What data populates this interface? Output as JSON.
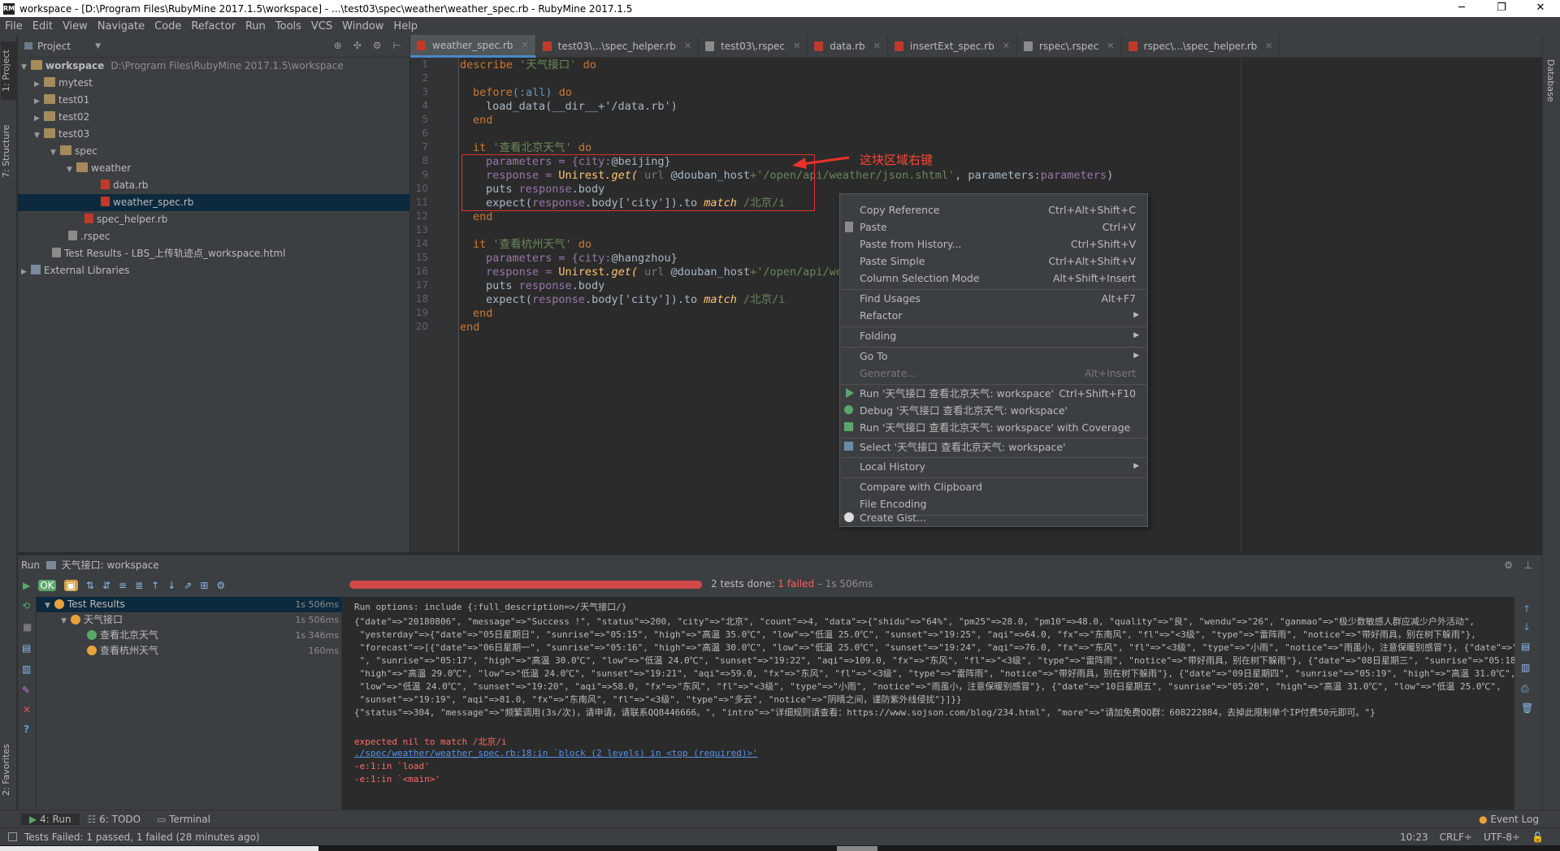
{
  "window": {
    "title": "workspace - [D:\\Program Files\\RubyMine 2017.1.5\\workspace] - ...\\test03\\spec\\weather\\weather_spec.rb - RubyMine 2017.1.5",
    "app_icon": "RM"
  },
  "menu": [
    "File",
    "Edit",
    "View",
    "Navigate",
    "Code",
    "Refactor",
    "Run",
    "Tools",
    "VCS",
    "Window",
    "Help"
  ],
  "left_strip": {
    "project": "1: Project",
    "structure": "7: Structure",
    "favorites": "2: Favorites"
  },
  "right_strip": {
    "database": "Database"
  },
  "project": {
    "header": "Project",
    "tree": [
      {
        "label": "workspace",
        "path": "D:\\Program Files\\RubyMine 2017.1.5\\workspace"
      },
      {
        "label": "mytest"
      },
      {
        "label": "test01"
      },
      {
        "label": "test02"
      },
      {
        "label": "test03"
      },
      {
        "label": "spec"
      },
      {
        "label": "weather"
      },
      {
        "label": "data.rb"
      },
      {
        "label": "weather_spec.rb"
      },
      {
        "label": "spec_helper.rb"
      },
      {
        "label": ".rspec"
      },
      {
        "label": "Test Results - LBS_上传轨迹点_workspace.html"
      },
      {
        "label": "External Libraries"
      }
    ]
  },
  "tabs": [
    "weather_spec.rb",
    "test03\\...\\spec_helper.rb",
    "test03\\.rspec",
    "data.rb",
    "insertExt_spec.rb",
    "rspec\\.rspec",
    "rspec\\...\\spec_helper.rb"
  ],
  "editor": {
    "line_numbers": [
      "1",
      "2",
      "3",
      "4",
      "5",
      "6",
      "7",
      "8",
      "9",
      "10",
      "11",
      "12",
      "13",
      "14",
      "15",
      "16",
      "17",
      "18",
      "19",
      "20"
    ],
    "code": {
      "l1_a": "describe",
      "l1_b": "'天气接口'",
      "l1_c": "do",
      "l3_a": "before",
      "l3_b": "(:all)",
      "l3_c": "do",
      "l4": "load_data(__dir__+'/data.rb')",
      "l5": "end",
      "l7_a": "it",
      "l7_b": "'查看北京天气'",
      "l7_c": "do",
      "l8_a": "parameters = {city:",
      "l8_b": "@beijing",
      "l8_c": "}",
      "l9_a": "response = ",
      "l9_b": "Unirest",
      "l9_c": ".get(",
      "l9_d": " url ",
      "l9_e": "@douban_host",
      "l9_f": "+'/open/api/weather/json.shtml'",
      "l9_g": ", parameters:",
      "l9_h": "parameters",
      "l9_i": ")",
      "l10_a": "puts ",
      "l10_b": "response",
      "l10_c": ".body",
      "l11_a": "expect(",
      "l11_b": "response",
      "l11_c": ".body['city']).to ",
      "l11_d": "match",
      "l11_e": " /北京/i",
      "l12": "end",
      "l14_a": "it",
      "l14_b": "'查看杭州天气'",
      "l14_c": "do",
      "l15_a": "parameters = {city:",
      "l15_b": "@hangzhou",
      "l15_c": "}",
      "l16_a": "response = ",
      "l16_b": "Unirest",
      "l16_c": ".get(",
      "l16_d": " url ",
      "l16_e": "@douban_host",
      "l16_f": "+'/open/api/weat",
      "l17_a": "puts ",
      "l17_b": "response",
      "l17_c": ".body",
      "l18_a": "expect(",
      "l18_b": "response",
      "l18_c": ".body['city']).to ",
      "l18_d": "match",
      "l18_e": " /北京/i",
      "l19": "end",
      "l20": "end"
    }
  },
  "annotation": "这块区域右键",
  "context_menu": [
    {
      "label": "Copy Reference",
      "shortcut": "Ctrl+Alt+Shift+C"
    },
    {
      "label": "Paste",
      "shortcut": "Ctrl+V"
    },
    {
      "label": "Paste from History...",
      "shortcut": "Ctrl+Shift+V"
    },
    {
      "label": "Paste Simple",
      "shortcut": "Ctrl+Alt+Shift+V"
    },
    {
      "label": "Column Selection Mode",
      "shortcut": "Alt+Shift+Insert"
    },
    {
      "label": "Find Usages",
      "shortcut": "Alt+F7"
    },
    {
      "label": "Refactor",
      "shortcut": ""
    },
    {
      "label": "Folding",
      "shortcut": ""
    },
    {
      "label": "Go To",
      "shortcut": ""
    },
    {
      "label": "Generate...",
      "shortcut": "Alt+Insert"
    },
    {
      "label": "Run '天气接口 查看北京天气: workspace'",
      "shortcut": "Ctrl+Shift+F10"
    },
    {
      "label": "Debug '天气接口 查看北京天气: workspace'",
      "shortcut": ""
    },
    {
      "label": "Run '天气接口 查看北京天气: workspace' with Coverage",
      "shortcut": ""
    },
    {
      "label": "Select '天气接口 查看北京天气: workspace'",
      "shortcut": ""
    },
    {
      "label": "Local History",
      "shortcut": ""
    },
    {
      "label": "Compare with Clipboard",
      "shortcut": ""
    },
    {
      "label": "File Encoding",
      "shortcut": ""
    },
    {
      "label": "Create Gist...",
      "shortcut": ""
    }
  ],
  "run": {
    "header_prefix": "Run",
    "config": "天气接口: workspace",
    "summary_a": "2 tests done: ",
    "summary_b": "1 failed",
    "summary_c": " – 1s 506ms",
    "progress_failed_fraction": 1.0,
    "tests": [
      {
        "label": "Test Results",
        "time": "1s 506ms"
      },
      {
        "label": "天气接口",
        "time": "1s 506ms"
      },
      {
        "label": "查看北京天气",
        "time": "1s 346ms"
      },
      {
        "label": "查看杭州天气",
        "time": "160ms"
      }
    ],
    "console": [
      "Run options: include {:full_description=>/天气接口/}",
      "{\"date\"=>\"20180806\", \"message\"=>\"Success !\", \"status\"=>200, \"city\"=>\"北京\", \"count\"=>4, \"data\"=>{\"shidu\"=>\"64%\", \"pm25\"=>28.0, \"pm10\"=>48.0, \"quality\"=>\"良\", \"wendu\"=>\"26\", \"ganmao\"=>\"极少数敏感人群应减少户外活动\",",
      " \"yesterday\"=>{\"date\"=>\"05日星期日\", \"sunrise\"=>\"05:15\", \"high\"=>\"高温 35.0℃\", \"low\"=>\"低温 25.0℃\", \"sunset\"=>\"19:25\", \"aqi\"=>64.0, \"fx\"=>\"东南风\", \"fl\"=>\"<3级\", \"type\"=>\"雷阵雨\", \"notice\"=>\"带好雨具，别在树下躲雨\"},",
      " \"forecast\"=>[{\"date\"=>\"06日星期一\", \"sunrise\"=>\"05:16\", \"high\"=>\"高温 30.0℃\", \"low\"=>\"低温 25.0℃\", \"sunset\"=>\"19:24\", \"aqi\"=>76.0, \"fx\"=>\"东风\", \"fl\"=>\"<3级\", \"type\"=>\"小雨\", \"notice\"=>\"雨虽小，注意保暖别感冒\"}, {\"date\"=>\"07日星期二",
      " \", \"sunrise\"=>\"05:17\", \"high\"=>\"高温 30.0℃\", \"low\"=>\"低温 24.0℃\", \"sunset\"=>\"19:22\", \"aqi\"=>109.0, \"fx\"=>\"东风\", \"fl\"=>\"<3级\", \"type\"=>\"雷阵雨\", \"notice\"=>\"带好雨具，别在树下躲雨\"}, {\"date\"=>\"08日星期三\", \"sunrise\"=>\"05:18\",",
      " \"high\"=>\"高温 29.0℃\", \"low\"=>\"低温 24.0℃\", \"sunset\"=>\"19:21\", \"aqi\"=>59.0, \"fx\"=>\"东风\", \"fl\"=>\"<3级\", \"type\"=>\"雷阵雨\", \"notice\"=>\"带好雨具，别在树下躲雨\"}, {\"date\"=>\"09日星期四\", \"sunrise\"=>\"05:19\", \"high\"=>\"高温 31.0℃\",",
      " \"low\"=>\"低温 24.0℃\", \"sunset\"=>\"19:20\", \"aqi\"=>58.0, \"fx\"=>\"东风\", \"fl\"=>\"<3级\", \"type\"=>\"小雨\", \"notice\"=>\"雨虽小，注意保暖别感冒\"}, {\"date\"=>\"10日星期五\", \"sunrise\"=>\"05:20\", \"high\"=>\"高温 31.0℃\", \"low\"=>\"低温 25.0℃\",",
      " \"sunset\"=>\"19:19\", \"aqi\"=>81.0, \"fx\"=>\"东南风\", \"fl\"=>\"<3级\", \"type\"=>\"多云\", \"notice\"=>\"阴晴之间，谨防紫外线侵扰\"}]}}",
      "{\"status\"=>304, \"message\"=>\"频繁调用(3s/次)，请申请，请联系QQ8446666。\", \"intro\"=>\"详细规则请查看：https://www.sojson.com/blog/234.html\", \"more\"=>\"请加免费QQ群：608222884，去掉此限制单个IP付费50元即可。\"}",
      "",
      "expected nil to match /北京/i",
      "./spec/weather/weather_spec.rb:18:in `block (2 levels) in <top (required)>'",
      "-e:1:in `load'",
      "-e:1:in `<main>'"
    ]
  },
  "bottom_tabs": [
    "4: Run",
    "6: TODO",
    "Terminal"
  ],
  "event_log": "Event Log",
  "status": {
    "message": "Tests Failed: 1 passed, 1 failed (28 minutes ago)",
    "pos": "10:23",
    "crlf": "CRLF÷",
    "enc": "UTF-8÷"
  }
}
